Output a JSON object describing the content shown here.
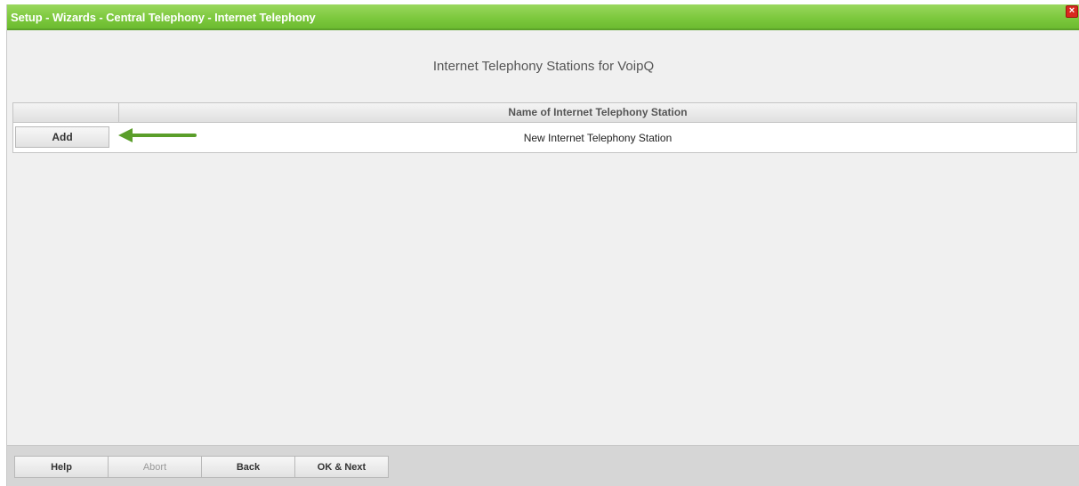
{
  "window": {
    "title": "Setup - Wizards - Central Telephony - Internet Telephony",
    "close_symbol": "×"
  },
  "page": {
    "heading": "Internet Telephony Stations for VoipQ"
  },
  "table": {
    "column_header": "Name of Internet Telephony Station",
    "rows": [
      {
        "action_label": "Add",
        "name": "New Internet Telephony Station"
      }
    ]
  },
  "annotation": {
    "arrow_color": "#5a9e2a"
  },
  "footer": {
    "buttons": [
      {
        "label": "Help",
        "enabled": true
      },
      {
        "label": "Abort",
        "enabled": false
      },
      {
        "label": "Back",
        "enabled": true
      },
      {
        "label": "OK & Next",
        "enabled": true
      }
    ]
  },
  "colors": {
    "titlebar": "#7dc93e",
    "background": "#f0f0f0",
    "footer": "#d6d6d6"
  }
}
